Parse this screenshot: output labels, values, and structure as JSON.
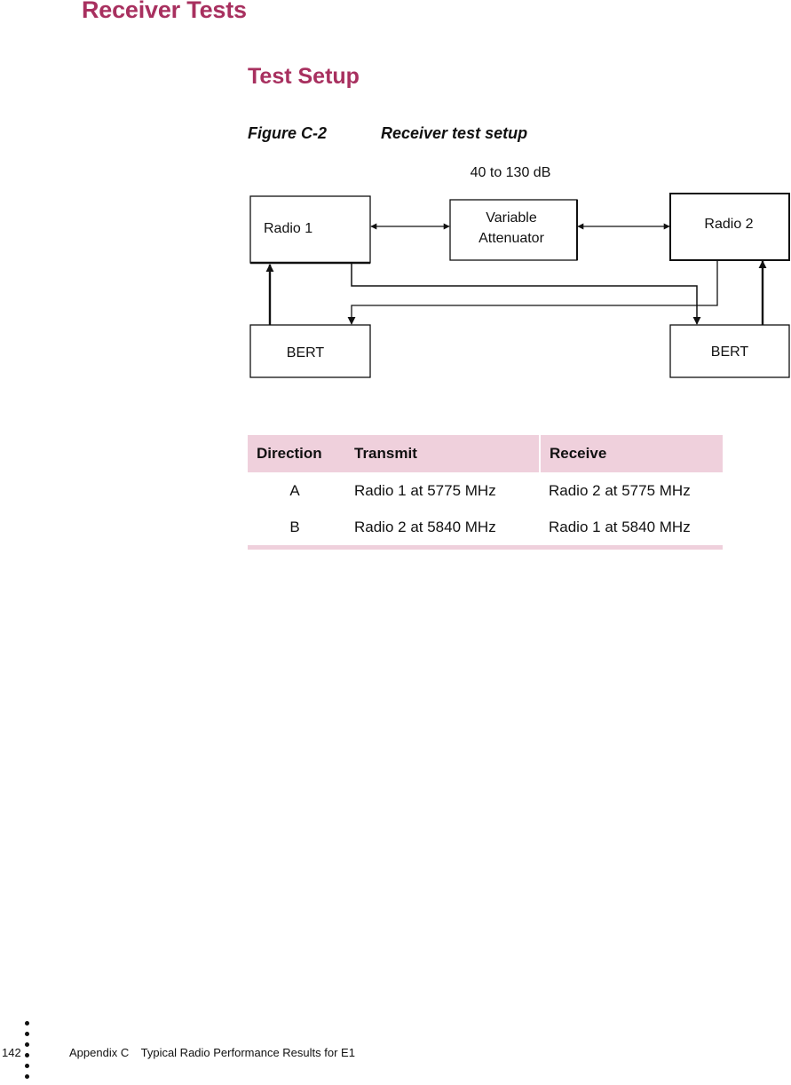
{
  "heading": "Receiver Tests",
  "subheading": "Test Setup",
  "figure": {
    "number": "Figure C-2",
    "title": "Receiver test setup",
    "attenuation_label": "40 to 130 dB",
    "blocks": {
      "radio1": "Radio 1",
      "attenuator_line1": "Variable",
      "attenuator_line2": "Attenuator",
      "radio2": "Radio 2",
      "bert_left": "BERT",
      "bert_right": "BERT"
    }
  },
  "table": {
    "headers": [
      "Direction",
      "Transmit",
      "Receive"
    ],
    "rows": [
      [
        "A",
        "Radio 1 at 5775 MHz",
        "Radio 2 at 5775 MHz"
      ],
      [
        "B",
        "Radio 2 at 5840 MHz",
        "Radio 1 at 5840 MHz"
      ]
    ]
  },
  "footer": {
    "page_number": "142",
    "appendix": "Appendix C",
    "section_title": "Typical Radio Performance Results for E1"
  },
  "colors": {
    "heading": "#a8305f",
    "table_header_bg": "#efd0dc"
  }
}
